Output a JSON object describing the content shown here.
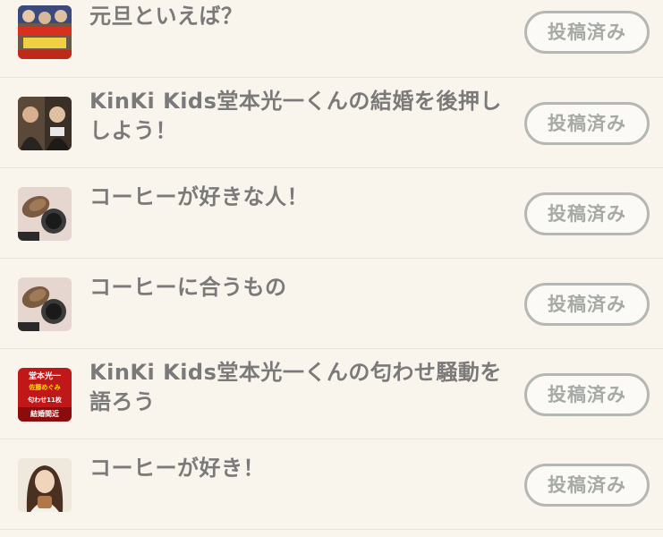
{
  "posted_label": "投稿済み",
  "topics": [
    {
      "title": "元旦といえば？",
      "thumb_icon": "newyear-photo-thumbnail"
    },
    {
      "title": "KinKi Kids堂本光一くんの結婚を後押ししよう！",
      "thumb_icon": "people-photo-thumbnail"
    },
    {
      "title": "コーヒーが好きな人！",
      "thumb_icon": "coffee-photo-thumbnail"
    },
    {
      "title": "コーヒーに合うもの",
      "thumb_icon": "coffee-photo-thumbnail"
    },
    {
      "title": "KinKi Kids堂本光一くんの匂わせ騒動を語ろう",
      "thumb_icon": "news-graphic-thumbnail",
      "thumb_text": [
        "堂本光一",
        "佐藤めぐみ",
        "匂わせ11枚",
        "結婚間近"
      ]
    },
    {
      "title": "コーヒーが好き！",
      "thumb_icon": "woman-coffee-photo-thumbnail"
    }
  ]
}
